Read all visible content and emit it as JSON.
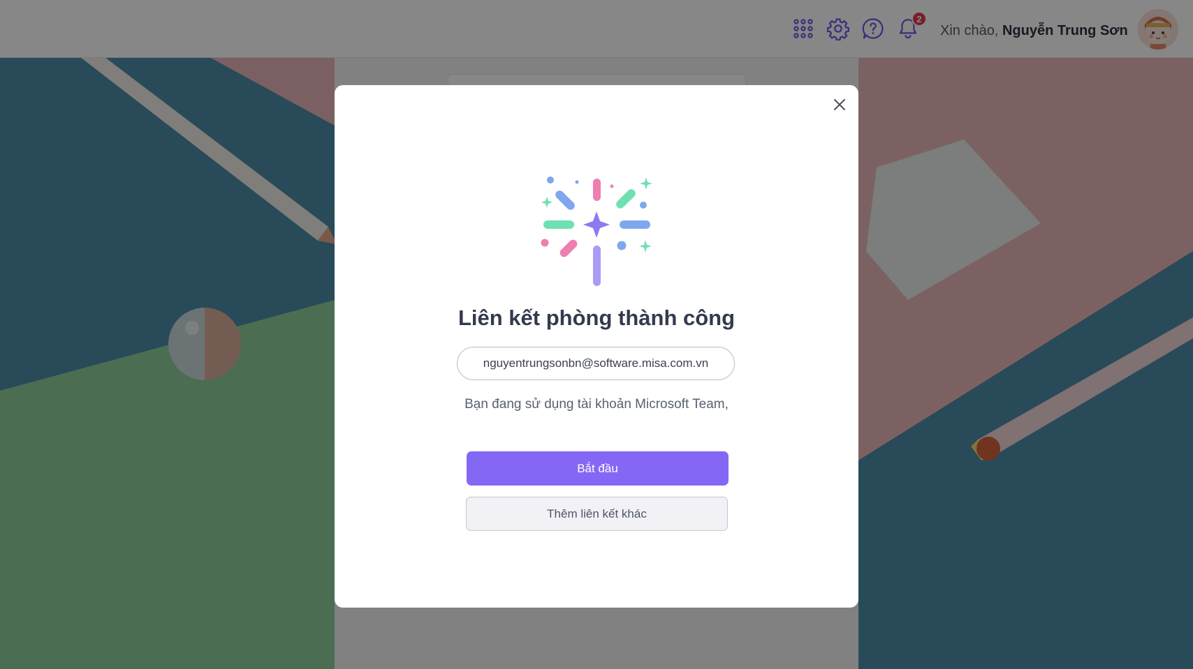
{
  "header": {
    "greeting_prefix": "Xin chào, ",
    "user_name": "Nguyễn Trung Sơn",
    "notification_count": "2",
    "icons": [
      "apps-grid-icon",
      "gear-icon",
      "help-icon",
      "bell-icon"
    ]
  },
  "modal": {
    "title": "Liên kết phòng thành công",
    "email": "nguyentrungsonbn@software.misa.com.vn",
    "note": "Bạn đang sử dụng tài khoản Microsoft Team,",
    "primary_button": "Bắt đầu",
    "secondary_button": "Thêm liên kết khác",
    "close_icon": "close-icon",
    "illustration": "celebration-sparkle-icon"
  },
  "colors": {
    "accent": "#8468f5",
    "icon": "#6c5ce7",
    "badge": "#e53956",
    "title": "#343a4e"
  }
}
